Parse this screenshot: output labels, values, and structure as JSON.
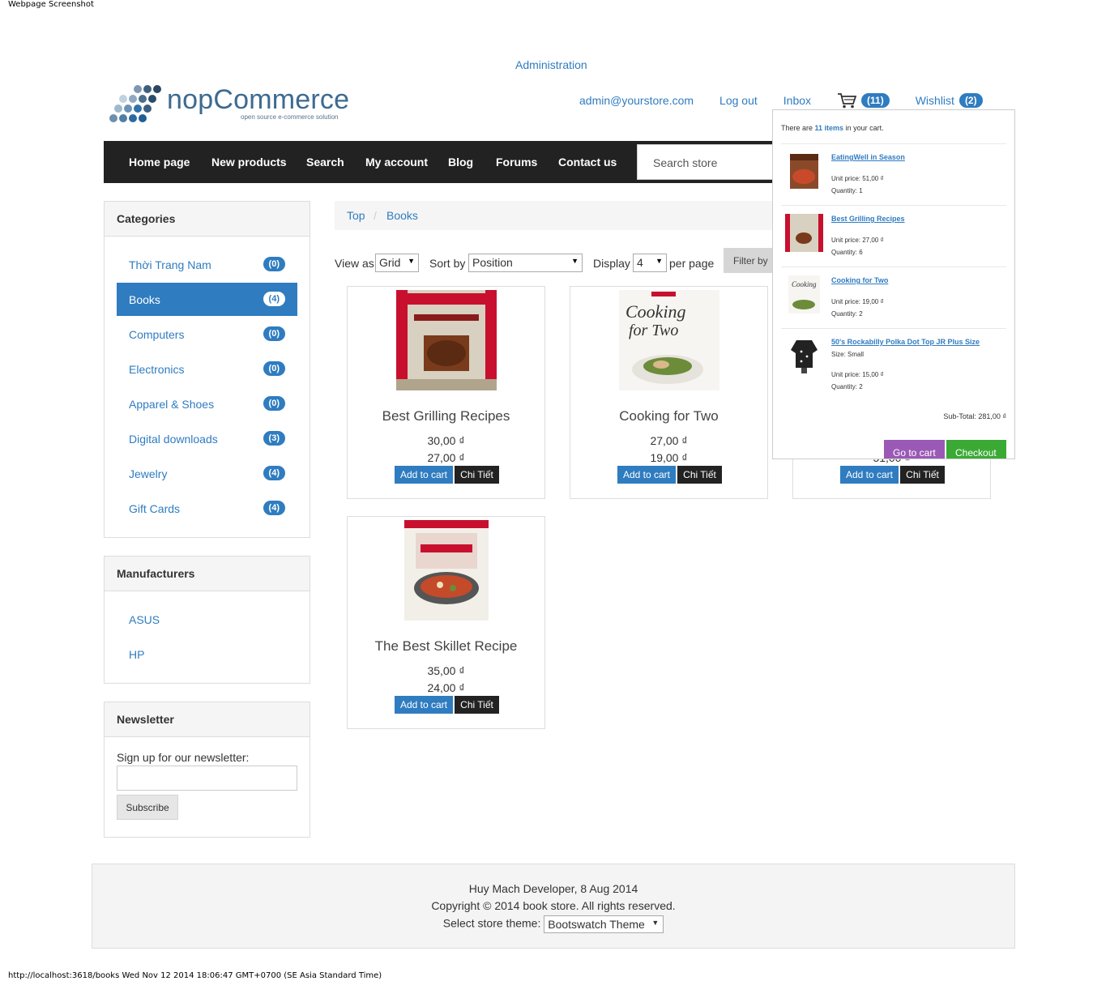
{
  "print_header": "Webpage Screenshot",
  "print_footer": "http://localhost:3618/books Wed Nov 12 2014 18:06:47 GMT+0700 (SE Asia Standard Time)",
  "admin_link": "Administration",
  "logo": {
    "name": "nopCommerce",
    "tagline": "open source e-commerce solution"
  },
  "header_links": {
    "email": "admin@yourstore.com",
    "logout": "Log out",
    "inbox": "Inbox",
    "cart_count": "(11)",
    "wishlist": "Wishlist",
    "wishlist_count": "(2)"
  },
  "nav": {
    "items": [
      "Home page",
      "New products",
      "Search",
      "My account",
      "Blog",
      "Forums",
      "Contact us"
    ],
    "search_placeholder": "Search store"
  },
  "categories": {
    "title": "Categories",
    "items": [
      {
        "label": "Thời Trang Nam",
        "count": "(0)"
      },
      {
        "label": "Books",
        "count": "(4)",
        "active": true
      },
      {
        "label": "Computers",
        "count": "(0)"
      },
      {
        "label": "Electronics",
        "count": "(0)"
      },
      {
        "label": "Apparel & Shoes",
        "count": "(0)"
      },
      {
        "label": "Digital downloads",
        "count": "(3)"
      },
      {
        "label": "Jewelry",
        "count": "(4)"
      },
      {
        "label": "Gift Cards",
        "count": "(4)"
      }
    ]
  },
  "manufacturers": {
    "title": "Manufacturers",
    "items": [
      "ASUS",
      "HP"
    ]
  },
  "newsletter": {
    "title": "Newsletter",
    "label": "Sign up for our newsletter:",
    "button": "Subscribe"
  },
  "breadcrumb": {
    "top": "Top",
    "separator": "/",
    "current": "Books"
  },
  "toolbar": {
    "view_as": "View as",
    "view_value": "Grid",
    "sort_by": "Sort by",
    "sort_value": "Position",
    "display": "Display",
    "display_value": "4",
    "per_page": "per page",
    "filter": "Filter by"
  },
  "products": [
    {
      "name": "Best Grilling Recipes",
      "old_price": "30,00 ₫",
      "price": "27,00 ₫",
      "add": "Add to cart",
      "detail": "Chi Tiết"
    },
    {
      "name": "Cooking for Two",
      "old_price": "27,00 ₫",
      "price": "19,00 ₫",
      "add": "Add to cart",
      "detail": "Chi Tiết"
    },
    {
      "name": "",
      "old_price": "",
      "price": "51,00 ₫",
      "add": "Add to cart",
      "detail": "Chi Tiết"
    },
    {
      "name": "The Best Skillet Recipe",
      "old_price": "35,00 ₫",
      "price": "24,00 ₫",
      "add": "Add to cart",
      "detail": "Chi Tiết"
    }
  ],
  "mini_cart": {
    "count_prefix": "There are ",
    "count_link": "11 items",
    "count_suffix": " in your cart.",
    "items": [
      {
        "name": "EatingWell in Season",
        "attr": "",
        "unit_price": "Unit price: 51,00 ₫",
        "quantity": "Quantity: 1"
      },
      {
        "name": "Best Grilling Recipes",
        "attr": "",
        "unit_price": "Unit price: 27,00 ₫",
        "quantity": "Quantity: 6"
      },
      {
        "name": "Cooking for Two",
        "attr": "",
        "unit_price": "Unit price: 19,00 ₫",
        "quantity": "Quantity: 2"
      },
      {
        "name": "50's Rockabilly Polka Dot Top JR Plus Size",
        "attr": "Size: Small",
        "unit_price": "Unit price: 15,00 ₫",
        "quantity": "Quantity: 2"
      }
    ],
    "subtotal": "Sub-Total: 281,00 ₫",
    "go_to_cart": "Go to cart",
    "checkout": "Checkout"
  },
  "footer": {
    "line1": "Huy Mach Developer, 8 Aug 2014",
    "line2": "Copyright © 2014 book store. All rights reserved.",
    "theme_label": "Select store theme:",
    "theme_value": "Bootswatch Theme"
  },
  "colors": {
    "link": "#2f7cc0",
    "nav_bg": "#222222",
    "go_to_cart": "#9b59b6",
    "checkout": "#3aaa35"
  }
}
